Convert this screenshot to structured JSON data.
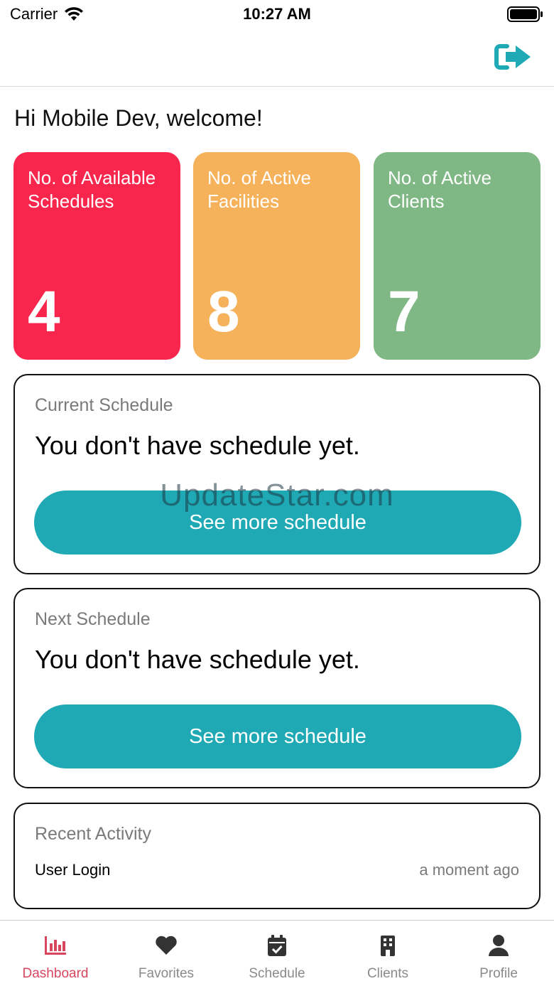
{
  "status_bar": {
    "carrier": "Carrier",
    "time": "10:27 AM"
  },
  "greeting": "Hi Mobile Dev, welcome!",
  "stats": [
    {
      "label": "No. of Available Schedules",
      "value": "4",
      "color": "#f8264c"
    },
    {
      "label": "No. of Active Facilities",
      "value": "8",
      "color": "#f6b15b"
    },
    {
      "label": "No. of Active Clients",
      "value": "7",
      "color": "#80b885"
    }
  ],
  "current_schedule": {
    "title": "Current Schedule",
    "message": "You don't have schedule yet.",
    "button": "See more schedule"
  },
  "next_schedule": {
    "title": "Next Schedule",
    "message": "You don't have schedule yet.",
    "button": "See more schedule"
  },
  "recent_activity": {
    "title": "Recent Activity",
    "items": [
      {
        "name": "User Login",
        "time": "a moment ago"
      }
    ]
  },
  "watermark": "UpdateStar.com",
  "tabs": [
    {
      "label": "Dashboard",
      "icon": "bar-chart-icon",
      "active": true
    },
    {
      "label": "Favorites",
      "icon": "heart-icon",
      "active": false
    },
    {
      "label": "Schedule",
      "icon": "calendar-check-icon",
      "active": false
    },
    {
      "label": "Clients",
      "icon": "building-icon",
      "active": false
    },
    {
      "label": "Profile",
      "icon": "user-icon",
      "active": false
    }
  ],
  "colors": {
    "accent": "#1ea9b4",
    "active_tab": "#d8465e",
    "inactive_tab": "#8a8a8a"
  }
}
